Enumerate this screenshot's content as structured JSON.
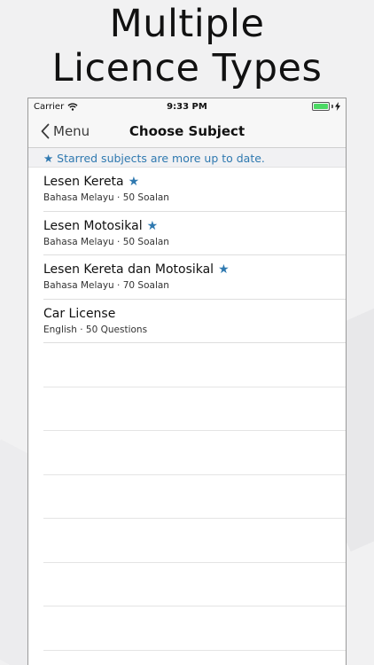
{
  "headline": {
    "line1": "Multiple",
    "line2": "Licence Types"
  },
  "status_bar": {
    "carrier": "Carrier",
    "time": "9:33 PM",
    "battery_level": 1.0
  },
  "nav": {
    "back_label": "Menu",
    "title": "Choose Subject"
  },
  "notice": "★ Starred subjects are more up to date.",
  "subjects": [
    {
      "title": "Lesen Kereta",
      "starred": true,
      "star": "★",
      "subtitle": "Bahasa Melayu · 50 Soalan"
    },
    {
      "title": "Lesen Motosikal",
      "starred": true,
      "star": "★",
      "subtitle": "Bahasa Melayu · 50 Soalan"
    },
    {
      "title": "Lesen Kereta dan Motosikal",
      "starred": true,
      "star": "★",
      "subtitle": "Bahasa Melayu · 70 Soalan"
    },
    {
      "title": "Car License",
      "starred": false,
      "star": "",
      "subtitle": "English · 50 Questions"
    }
  ],
  "colors": {
    "accent": "#2f79b0",
    "battery": "#4cd964"
  }
}
